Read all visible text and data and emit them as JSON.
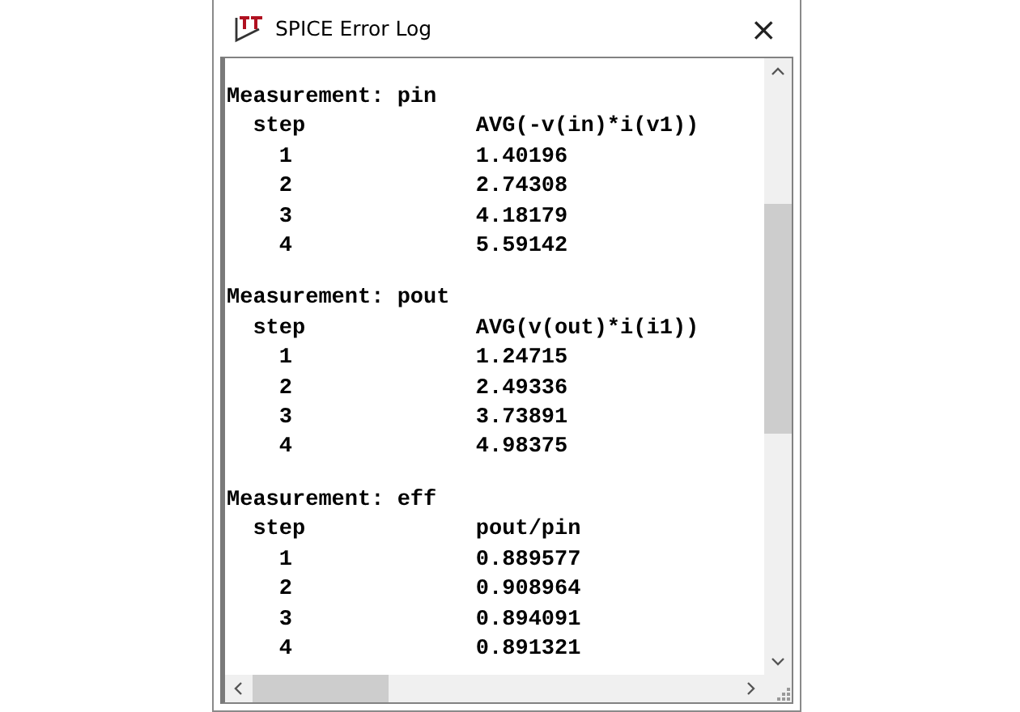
{
  "window": {
    "title": "SPICE Error Log",
    "close": "×"
  },
  "measurements": [
    {
      "heading": "Measurement: pin",
      "step_header": "step",
      "value_header": "AVG(-v(in)*i(v1))",
      "rows": [
        {
          "step": "1",
          "value": "1.40196"
        },
        {
          "step": "2",
          "value": "2.74308"
        },
        {
          "step": "3",
          "value": "4.18179"
        },
        {
          "step": "4",
          "value": "5.59142"
        }
      ]
    },
    {
      "heading": "Measurement: pout",
      "step_header": "step",
      "value_header": "AVG(v(out)*i(i1))",
      "rows": [
        {
          "step": "1",
          "value": "1.24715"
        },
        {
          "step": "2",
          "value": "2.49336"
        },
        {
          "step": "3",
          "value": "3.73891"
        },
        {
          "step": "4",
          "value": "4.98375"
        }
      ]
    },
    {
      "heading": "Measurement: eff",
      "step_header": "step",
      "value_header": "pout/pin",
      "rows": [
        {
          "step": "1",
          "value": "0.889577"
        },
        {
          "step": "2",
          "value": "0.908964"
        },
        {
          "step": "3",
          "value": "0.894091"
        },
        {
          "step": "4",
          "value": "0.891321"
        }
      ]
    }
  ]
}
